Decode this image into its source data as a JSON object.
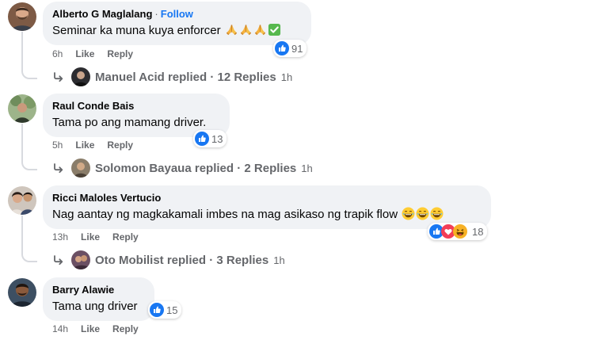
{
  "comments": [
    {
      "author": "Alberto G Maglalang",
      "separator": "·",
      "follow": "Follow",
      "text": "Seminar ka muna kuya enforcer",
      "emojis": [
        "folded-hands-emoji",
        "folded-hands-emoji",
        "folded-hands-emoji",
        "check-mark-button-emoji"
      ],
      "reaction_icons": [
        "like"
      ],
      "reaction_count": "91",
      "time": "6h",
      "like_label": "Like",
      "reply_label": "Reply",
      "replies": {
        "name": "Manuel Acid",
        "verb": "replied",
        "dot": "·",
        "count_label": "12 Replies",
        "time": "1h"
      }
    },
    {
      "author": "Raul Conde Bais",
      "text": "Tama po ang mamang driver.",
      "emojis": [],
      "reaction_icons": [
        "like"
      ],
      "reaction_count": "13",
      "time": "5h",
      "like_label": "Like",
      "reply_label": "Reply",
      "replies": {
        "name": "Solomon Bayaua",
        "verb": "replied",
        "dot": "·",
        "count_label": "2 Replies",
        "time": "1h"
      }
    },
    {
      "author": "Ricci Maloles Vertucio",
      "text": "Nag aantay ng magkakamali imbes na mag asikaso ng trapik flow",
      "emojis": [
        "laughing-emoji",
        "laughing-emoji",
        "laughing-emoji"
      ],
      "reaction_icons": [
        "like",
        "love",
        "haha"
      ],
      "reaction_count": "18",
      "time": "13h",
      "like_label": "Like",
      "reply_label": "Reply",
      "replies": {
        "name": "Oto Mobilist",
        "verb": "replied",
        "dot": "·",
        "count_label": "3 Replies",
        "time": "1h"
      }
    },
    {
      "author": "Barry Alawie",
      "text": "Tama ung driver",
      "emojis": [],
      "reaction_icons": [
        "like"
      ],
      "reaction_count": "15",
      "time": "14h",
      "like_label": "Like",
      "reply_label": "Reply"
    }
  ],
  "colors": {
    "like": "#1877f2",
    "love": "#f33e58",
    "haha": "#f7b125",
    "meta": "#65676b",
    "bubble": "#f0f2f5"
  }
}
